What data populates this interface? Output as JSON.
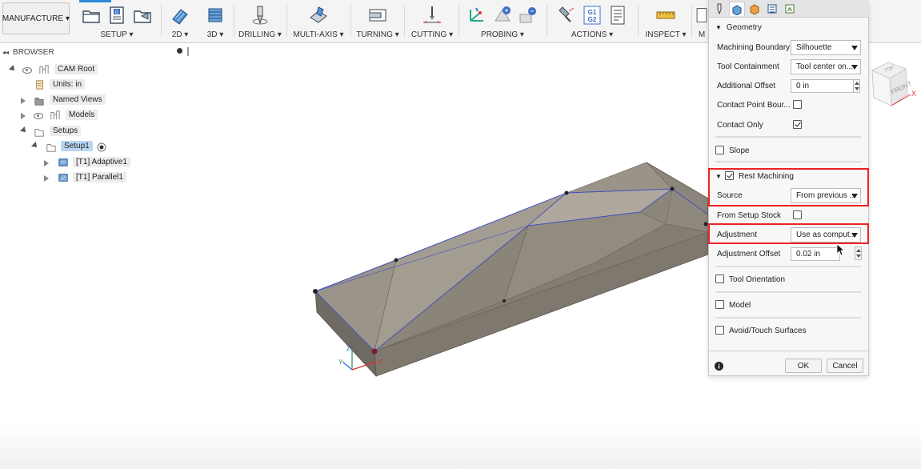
{
  "toolbar": {
    "workspace": "MANUFACTURE",
    "groups": [
      {
        "label": "SETUP",
        "icons": [
          "setup-folder-icon",
          "g-code-icon",
          "setup-sheet-icon"
        ]
      },
      {
        "label": "2D",
        "icons": [
          "2d-adaptive-icon"
        ]
      },
      {
        "label": "3D",
        "icons": [
          "3d-clearing-icon"
        ]
      },
      {
        "label": "DRILLING",
        "icons": [
          "drill-icon"
        ]
      },
      {
        "label": "MULTI-AXIS",
        "icons": [
          "multi-axis-icon"
        ]
      },
      {
        "label": "TURNING",
        "icons": [
          "turning-icon"
        ]
      },
      {
        "label": "CUTTING",
        "icons": [
          "cutting-icon"
        ]
      },
      {
        "label": "PROBING",
        "icons": [
          "wcs-probe-icon",
          "probe-geometry-icon",
          "probe-part-icon"
        ]
      },
      {
        "label": "ACTIONS",
        "icons": [
          "simulate-icon",
          "post-process-icon",
          "setup-sheet-doc-icon"
        ]
      },
      {
        "label": "INSPECT",
        "icons": [
          "measure-icon"
        ]
      },
      {
        "label": "M",
        "icons": [
          "manage-icon"
        ]
      }
    ],
    "g1g2_text": "G1\nG2",
    "g_text": "G"
  },
  "browser": {
    "title": "BROWSER",
    "root": "CAM Root",
    "units": "Units: in",
    "named_views": "Named Views",
    "models": "Models",
    "setups": "Setups",
    "setup1": "Setup1",
    "op1": "[T1] Adaptive1",
    "op2": "[T1] Parallel1"
  },
  "panel": {
    "geometry_header": "Geometry",
    "machining_boundary_label": "Machining Boundary",
    "machining_boundary_value": "Silhouette",
    "tool_containment_label": "Tool Containment",
    "tool_containment_value": "Tool center on...",
    "additional_offset_label": "Additional Offset",
    "additional_offset_value": "0 in",
    "contact_point_label": "Contact Point Bour...",
    "contact_only_label": "Contact Only",
    "slope_label": "Slope",
    "rest_machining_label": "Rest Machining",
    "source_label": "Source",
    "source_value": "From previous ...",
    "from_setup_stock_label": "From Setup Stock",
    "adjustment_label": "Adjustment",
    "adjustment_value": "Use as comput...",
    "adjustment_offset_label": "Adjustment Offset",
    "adjustment_offset_value": "0.02 in",
    "tool_orientation_label": "Tool Orientation",
    "model_label": "Model",
    "avoid_label": "Avoid/Touch Surfaces",
    "ok_label": "OK",
    "cancel_label": "Cancel",
    "checked": {
      "contact_point": false,
      "contact_only": true,
      "slope": false,
      "rest_machining": true,
      "from_setup_stock": false,
      "tool_orientation": false,
      "model": false,
      "avoid": false
    }
  },
  "viewcube": {
    "top": "TOP",
    "front": "FRONT",
    "x": "X"
  },
  "triad": {
    "z": "Z",
    "y": "Y",
    "x": "X"
  },
  "colors": {
    "highlight": "#e22222",
    "accent": "#2b8ad8",
    "part": "#8a847a"
  }
}
